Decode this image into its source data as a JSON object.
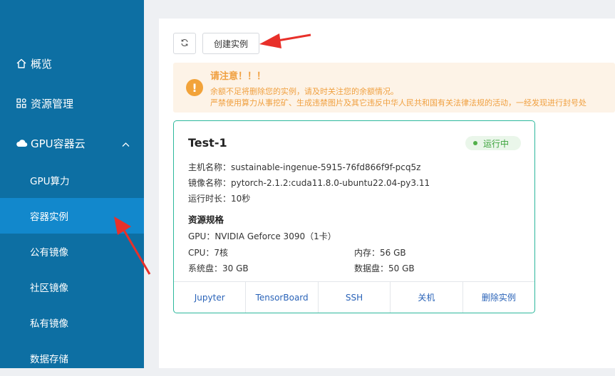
{
  "sidebar": {
    "items": [
      {
        "label": "概览",
        "icon": "home-icon"
      },
      {
        "label": "资源管理",
        "icon": "grid-icon"
      },
      {
        "label": "GPU容器云",
        "icon": "cloud-icon",
        "expanded": true
      }
    ],
    "sub_items": [
      {
        "label": "GPU算力",
        "active": false
      },
      {
        "label": "容器实例",
        "active": true
      },
      {
        "label": "公有镜像",
        "active": false
      },
      {
        "label": "社区镜像",
        "active": false
      },
      {
        "label": "私有镜像",
        "active": false
      },
      {
        "label": "数据存储",
        "active": false
      }
    ]
  },
  "toolbar": {
    "refresh_icon": "refresh-icon",
    "create_label": "创建实例"
  },
  "alert": {
    "title": "请注意！！！",
    "line1": "余额不足将删除您的实例，请及时关注您的余额情况。",
    "line2": "严禁使用算力从事挖矿、生成违禁图片及其它违反中华人民共和国有关法律法规的活动，一经发现进行封号处"
  },
  "instance": {
    "name": "Test-1",
    "status": "运行中",
    "host": "主机名称：sustainable-ingenue-5915-76fd866f9f-pcq5z",
    "image": "镜像名称：pytorch-2.1.2:cuda11.8.0-ubuntu22.04-py3.11",
    "runtime": "运行时长：10秒",
    "spec_title": "资源规格",
    "gpu": "GPU：NVIDIA Geforce 3090（1卡）",
    "cpu": "CPU：7核",
    "memory": "内存：56 GB",
    "system_disk": "系统盘：30 GB",
    "data_disk": "数据盘：50 GB",
    "actions": [
      "Jupyter",
      "TensorBoard",
      "SSH",
      "关机",
      "删除实例"
    ]
  },
  "colors": {
    "sidebar": "#0d6fa3",
    "sidebar_active": "#1288cc",
    "card_border": "#2db89c",
    "alert_text": "#f0a040",
    "action_link": "#2a63b8",
    "annotation_arrow": "#e8302a"
  }
}
